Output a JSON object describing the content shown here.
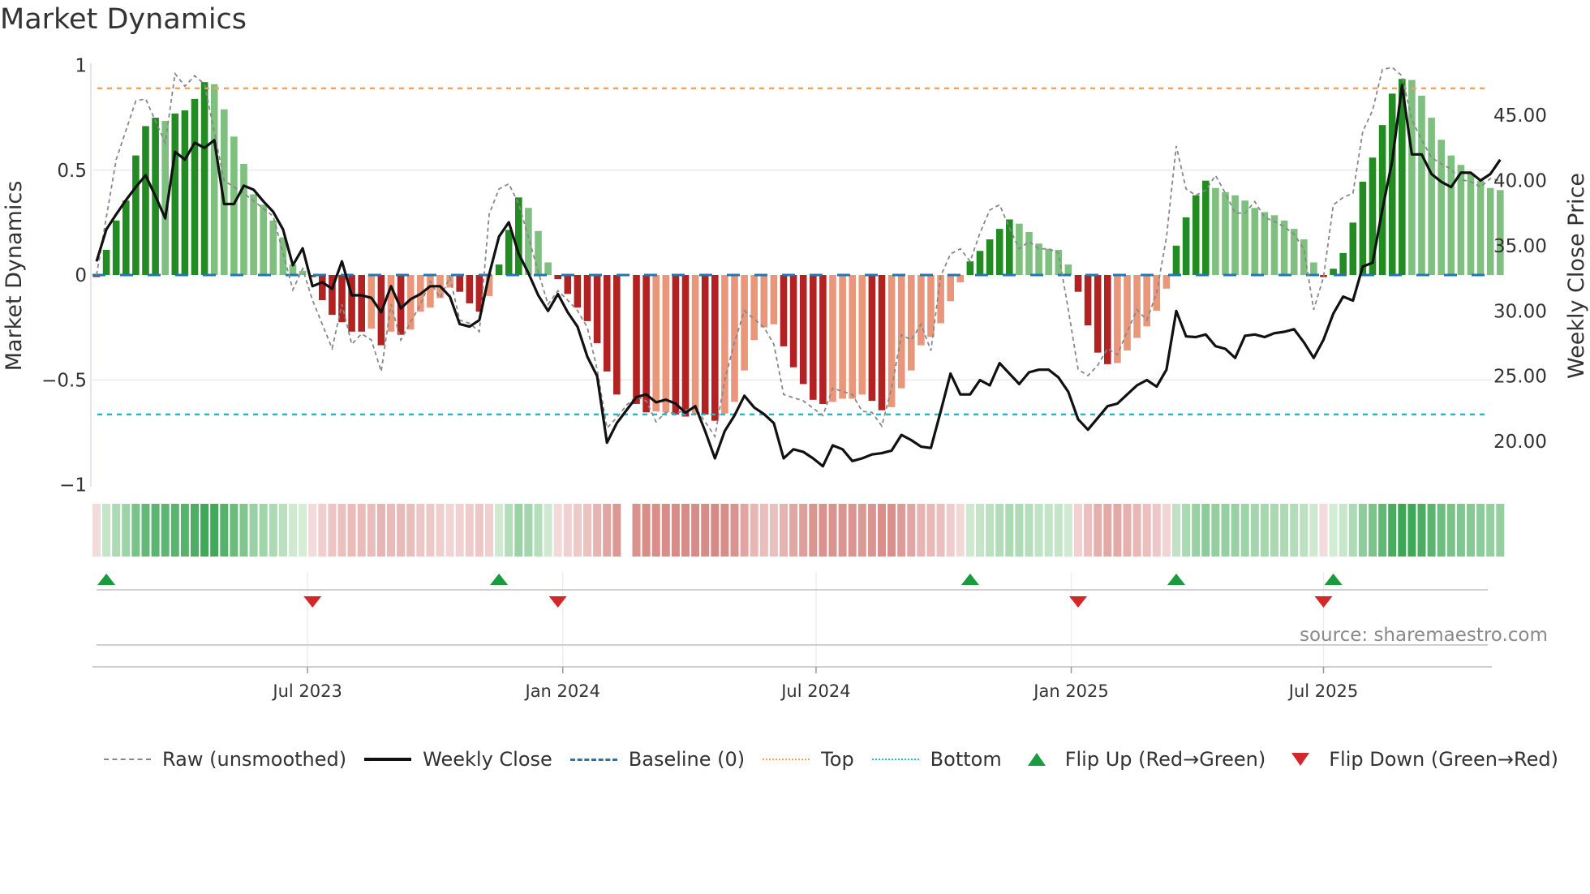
{
  "title": "Market Dynamics",
  "source": "source: sharemaestro.com",
  "colors": {
    "dark_green": "#228b22",
    "light_green": "#7fbf7f",
    "dark_red": "#b22222",
    "light_red": "#e9967a",
    "baseline": "#1f77b4",
    "top": "#f4a460",
    "bottom": "#17becf",
    "raw": "#888888",
    "close": "#111111",
    "flip_up": "#1a9c3e",
    "flip_down": "#d62728"
  },
  "legend": [
    {
      "label": "Raw (unsmoothed)"
    },
    {
      "label": "Weekly Close"
    },
    {
      "label": "Baseline (0)"
    },
    {
      "label": "Top"
    },
    {
      "label": "Bottom"
    },
    {
      "label": "Flip Up (Red→Green)"
    },
    {
      "label": "Flip Down (Green→Red)"
    }
  ],
  "chart_data": {
    "type": "bar",
    "title": "Market Dynamics",
    "ylabel": "Market Dynamics",
    "y2label": "Weekly Close Price",
    "ylim": [
      -1,
      1
    ],
    "y2lim": [
      16.65,
      48.8
    ],
    "yticks": [
      {
        "v": 1,
        "label": "1"
      },
      {
        "v": 0.5,
        "label": "0.5"
      },
      {
        "v": 0,
        "label": "0"
      },
      {
        "v": -0.5,
        "label": "−0.5"
      },
      {
        "v": -1,
        "label": "−1"
      }
    ],
    "y2ticks": [
      {
        "v": 45,
        "label": "45.00"
      },
      {
        "v": 40,
        "label": "40.00"
      },
      {
        "v": 35,
        "label": "35.00"
      },
      {
        "v": 30,
        "label": "30.00"
      },
      {
        "v": 25,
        "label": "25.00"
      },
      {
        "v": 20,
        "label": "20.00"
      }
    ],
    "xticks": [
      {
        "week_index": 21.5,
        "label": "Jul 2023"
      },
      {
        "week_index": 47.5,
        "label": "Jan 2024"
      },
      {
        "week_index": 73.3,
        "label": "Jul 2024"
      },
      {
        "week_index": 99.3,
        "label": "Jan 2025"
      },
      {
        "week_index": 125.0,
        "label": "Jul 2025"
      }
    ],
    "top_level": 0.89,
    "bottom_level": -0.665,
    "baseline": 0,
    "dynamics": [
      -0.01,
      0.12,
      0.26,
      0.355,
      0.57,
      0.71,
      0.75,
      0.735,
      0.77,
      0.785,
      0.84,
      0.92,
      0.91,
      0.79,
      0.66,
      0.53,
      0.385,
      0.335,
      0.26,
      0.18,
      0.05,
      0.02,
      -0.01,
      -0.12,
      -0.19,
      -0.225,
      -0.27,
      -0.27,
      -0.255,
      -0.335,
      -0.27,
      -0.285,
      -0.26,
      -0.175,
      -0.155,
      -0.11,
      -0.06,
      -0.08,
      -0.135,
      -0.175,
      -0.1,
      0.05,
      0.215,
      0.37,
      0.32,
      0.21,
      0.06,
      -0.02,
      -0.09,
      -0.155,
      -0.22,
      -0.325,
      -0.46,
      -0.57,
      null,
      -0.615,
      -0.655,
      -0.65,
      -0.655,
      -0.665,
      -0.675,
      -0.665,
      -0.665,
      -0.695,
      -0.66,
      -0.605,
      -0.455,
      -0.31,
      -0.25,
      -0.235,
      -0.34,
      -0.44,
      -0.52,
      -0.595,
      -0.615,
      -0.605,
      -0.59,
      -0.59,
      -0.57,
      -0.6,
      -0.645,
      -0.63,
      -0.54,
      -0.455,
      -0.335,
      -0.295,
      -0.23,
      -0.125,
      -0.035,
      0.065,
      0.115,
      0.17,
      0.22,
      0.265,
      0.245,
      0.205,
      0.15,
      0.125,
      0.12,
      0.05,
      -0.08,
      -0.24,
      -0.37,
      -0.425,
      -0.42,
      -0.36,
      -0.3,
      -0.245,
      -0.17,
      -0.065,
      0.14,
      0.275,
      0.38,
      0.45,
      0.415,
      0.395,
      0.38,
      0.355,
      0.32,
      0.3,
      0.285,
      0.26,
      0.22,
      0.17,
      0.06,
      -0.01,
      0.03,
      0.105,
      0.25,
      0.445,
      0.56,
      0.715,
      0.865,
      0.935,
      0.93,
      0.855,
      0.75,
      0.645,
      0.57,
      0.525,
      0.485,
      0.45,
      0.415,
      0.405
    ],
    "strengthening": [
      1,
      1,
      1,
      1,
      1,
      1,
      1,
      0,
      1,
      1,
      1,
      1,
      0,
      0,
      0,
      0,
      0,
      0,
      0,
      0,
      0,
      0,
      1,
      1,
      1,
      1,
      1,
      1,
      0,
      1,
      0,
      1,
      0,
      0,
      0,
      0,
      0,
      1,
      1,
      1,
      0,
      1,
      1,
      1,
      0,
      0,
      0,
      1,
      1,
      1,
      1,
      1,
      1,
      1,
      0,
      1,
      1,
      0,
      0,
      1,
      1,
      0,
      1,
      1,
      0,
      0,
      0,
      0,
      0,
      0,
      1,
      1,
      1,
      1,
      1,
      0,
      0,
      0,
      0,
      1,
      1,
      0,
      0,
      0,
      0,
      0,
      0,
      0,
      0,
      1,
      1,
      1,
      1,
      1,
      0,
      0,
      0,
      0,
      0,
      0,
      1,
      1,
      1,
      1,
      0,
      0,
      0,
      0,
      0,
      0,
      1,
      1,
      1,
      1,
      0,
      0,
      0,
      0,
      0,
      0,
      0,
      0,
      0,
      0,
      0,
      1,
      1,
      1,
      1,
      1,
      1,
      1,
      1,
      1,
      0,
      0,
      0,
      0,
      0,
      0,
      0,
      0,
      0,
      0
    ],
    "weekly_close": [
      33.8,
      36.25,
      37.4,
      38.5,
      39.5,
      40.4,
      38.8,
      37.1,
      42.2,
      41.6,
      42.9,
      42.5,
      43.1,
      38.2,
      38.2,
      39.6,
      39.3,
      38.4,
      37.6,
      36.25,
      33.5,
      34.8,
      31.9,
      32.2,
      31.7,
      33.8,
      31.2,
      31.2,
      31.0,
      29.9,
      31.9,
      30.2,
      30.9,
      31.3,
      31.9,
      31.9,
      31.1,
      29.0,
      28.8,
      29.3,
      32.8,
      35.7,
      36.8,
      34.4,
      32.9,
      31.2,
      30.0,
      31.3,
      29.9,
      28.8,
      26.5,
      25.0,
      19.9,
      21.4,
      22.4,
      23.4,
      23.6,
      23.0,
      23.2,
      22.9,
      22.2,
      22.7,
      20.8,
      18.7,
      20.8,
      22.0,
      23.5,
      22.6,
      22.1,
      21.4,
      18.7,
      19.4,
      19.2,
      18.7,
      18.1,
      19.7,
      19.4,
      18.5,
      18.7,
      19.0,
      19.1,
      19.3,
      20.5,
      20.1,
      19.6,
      19.5,
      22.3,
      25.2,
      23.6,
      23.6,
      24.7,
      24.3,
      26.0,
      25.2,
      24.4,
      25.3,
      25.5,
      25.5,
      24.9,
      23.8,
      21.7,
      20.9,
      21.8,
      22.7,
      22.9,
      23.6,
      24.3,
      24.7,
      24.2,
      25.5,
      30.0,
      28.05,
      28.0,
      28.2,
      27.3,
      27.1,
      26.4,
      28.1,
      28.2,
      28.0,
      28.3,
      28.4,
      28.6,
      27.6,
      26.4,
      27.8,
      29.8,
      31.1,
      30.8,
      33.4,
      33.7,
      37.8,
      41.5,
      47.3,
      42.0,
      42.0,
      40.5,
      39.9,
      39.5,
      40.6,
      40.6,
      40.0,
      40.5,
      41.6
    ],
    "raw_knots": [
      [
        1,
        0
      ],
      [
        3,
        0.55
      ],
      [
        5,
        0.83
      ],
      [
        6,
        0.84
      ],
      [
        8,
        0.63
      ],
      [
        9,
        0.96
      ],
      [
        10,
        0.9
      ],
      [
        11,
        0.95
      ],
      [
        12,
        0.91
      ],
      [
        14,
        0.45
      ],
      [
        16,
        0.39
      ],
      [
        19,
        0.28
      ],
      [
        21,
        -0.07
      ],
      [
        22,
        0.03
      ],
      [
        23,
        -0.12
      ],
      [
        25,
        -0.35
      ],
      [
        26,
        -0.14
      ],
      [
        27,
        -0.33
      ],
      [
        28,
        -0.28
      ],
      [
        29,
        -0.31
      ],
      [
        30,
        -0.46
      ],
      [
        31,
        -0.14
      ],
      [
        32,
        -0.31
      ],
      [
        34,
        -0.14
      ],
      [
        35,
        -0.03
      ],
      [
        36,
        -0.11
      ],
      [
        37,
        -0.01
      ],
      [
        38,
        -0.215
      ],
      [
        39,
        -0.23
      ],
      [
        40,
        -0.27
      ],
      [
        41,
        0.29
      ],
      [
        42,
        0.41
      ],
      [
        43,
        0.435
      ],
      [
        44,
        0.34
      ],
      [
        45,
        0.18
      ],
      [
        46,
        0.015
      ],
      [
        47,
        -0.14
      ],
      [
        48,
        -0.075
      ],
      [
        49,
        -0.12
      ],
      [
        50,
        -0.17
      ],
      [
        51,
        -0.25
      ],
      [
        52,
        -0.45
      ],
      [
        53,
        -0.73
      ],
      [
        54,
        -0.68
      ],
      [
        55,
        -0.62
      ],
      [
        56,
        -0.58
      ],
      [
        57,
        -0.6
      ],
      [
        58,
        -0.7
      ],
      [
        59,
        -0.655
      ],
      [
        60,
        -0.66
      ],
      [
        62,
        -0.63
      ],
      [
        64,
        -0.77
      ],
      [
        65,
        -0.5
      ],
      [
        66,
        -0.32
      ],
      [
        67,
        -0.17
      ],
      [
        68,
        -0.21
      ],
      [
        69,
        -0.25
      ],
      [
        70,
        -0.33
      ],
      [
        71,
        -0.57
      ],
      [
        73,
        -0.6
      ],
      [
        75,
        -0.67
      ],
      [
        76,
        -0.54
      ],
      [
        78,
        -0.57
      ],
      [
        79,
        -0.65
      ],
      [
        80,
        -0.655
      ],
      [
        81,
        -0.72
      ],
      [
        82,
        -0.54
      ],
      [
        83,
        -0.285
      ],
      [
        84,
        -0.31
      ],
      [
        85,
        -0.235
      ],
      [
        86,
        -0.36
      ],
      [
        87,
        -0.005
      ],
      [
        88,
        0.1
      ],
      [
        89,
        0.125
      ],
      [
        90,
        0.065
      ],
      [
        91,
        0.2
      ],
      [
        92,
        0.31
      ],
      [
        93,
        0.335
      ],
      [
        94,
        0.225
      ],
      [
        95,
        0.125
      ],
      [
        96,
        0.16
      ],
      [
        97,
        0.125
      ],
      [
        98,
        0.125
      ],
      [
        99,
        0.105
      ],
      [
        100,
        -0.165
      ],
      [
        101,
        -0.45
      ],
      [
        102,
        -0.48
      ],
      [
        103,
        -0.43
      ],
      [
        104,
        -0.35
      ],
      [
        105,
        -0.38
      ],
      [
        106,
        -0.27
      ],
      [
        107,
        -0.165
      ],
      [
        108,
        -0.215
      ],
      [
        109,
        -0.085
      ],
      [
        110,
        0.18
      ],
      [
        111,
        0.615
      ],
      [
        112,
        0.41
      ],
      [
        113,
        0.38
      ],
      [
        114,
        0.405
      ],
      [
        115,
        0.475
      ],
      [
        116,
        0.39
      ],
      [
        117,
        0.295
      ],
      [
        118,
        0.295
      ],
      [
        119,
        0.35
      ],
      [
        120,
        0.275
      ],
      [
        121,
        0.255
      ],
      [
        122,
        0.23
      ],
      [
        123,
        0.195
      ],
      [
        124,
        0.125
      ],
      [
        125,
        -0.165
      ],
      [
        126,
        -0.01
      ],
      [
        127,
        0.335
      ],
      [
        128,
        0.37
      ],
      [
        129,
        0.39
      ],
      [
        130,
        0.685
      ],
      [
        131,
        0.785
      ],
      [
        132,
        0.98
      ],
      [
        133,
        0.99
      ],
      [
        134,
        0.95
      ],
      [
        135,
        0.74
      ],
      [
        136,
        0.645
      ],
      [
        137,
        0.56
      ],
      [
        138,
        0.53
      ],
      [
        139,
        0.505
      ],
      [
        140,
        0.455
      ],
      [
        141,
        0.445
      ],
      [
        142,
        0.42
      ],
      [
        143,
        0.46
      ],
      [
        144,
        0.45
      ]
    ],
    "flip_up_weeks": [
      2,
      42,
      90,
      111,
      127
    ],
    "flip_down_weeks": [
      23,
      48,
      101,
      126
    ],
    "grid": true,
    "legend_position": "bottom"
  }
}
